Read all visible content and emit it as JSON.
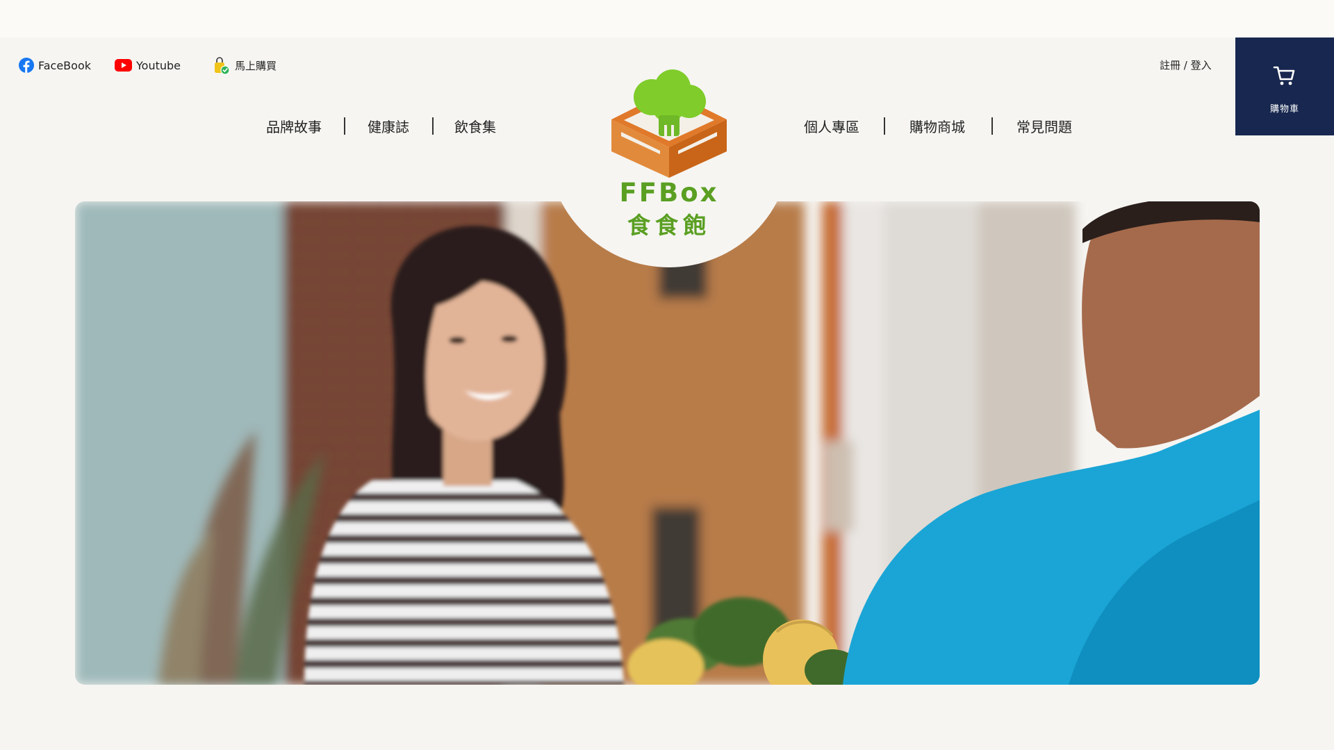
{
  "social": {
    "facebook_label": "FaceBook",
    "youtube_label": "Youtube",
    "buy_now_label": "馬上購買"
  },
  "auth": {
    "label": "註冊 / 登入"
  },
  "cart": {
    "label": "購物車"
  },
  "nav": {
    "left": [
      "品牌故事",
      "健康誌",
      "飲食集"
    ],
    "right": [
      "個人專區",
      "購物商城",
      "常見問題"
    ]
  },
  "logo": {
    "wordmark": "FFBox",
    "chinese_name": "食食飽"
  },
  "colors": {
    "background": "#f6f5f2",
    "cart_bg": "#17274f",
    "logo_green": "#5a9f22",
    "box_orange": "#e0792a",
    "facebook_blue": "#1877f2",
    "youtube_red": "#ff0000"
  },
  "icons": {
    "facebook": "facebook-icon",
    "youtube": "youtube-icon",
    "buy": "shopping-bag-check-icon",
    "cart": "cart-icon"
  }
}
